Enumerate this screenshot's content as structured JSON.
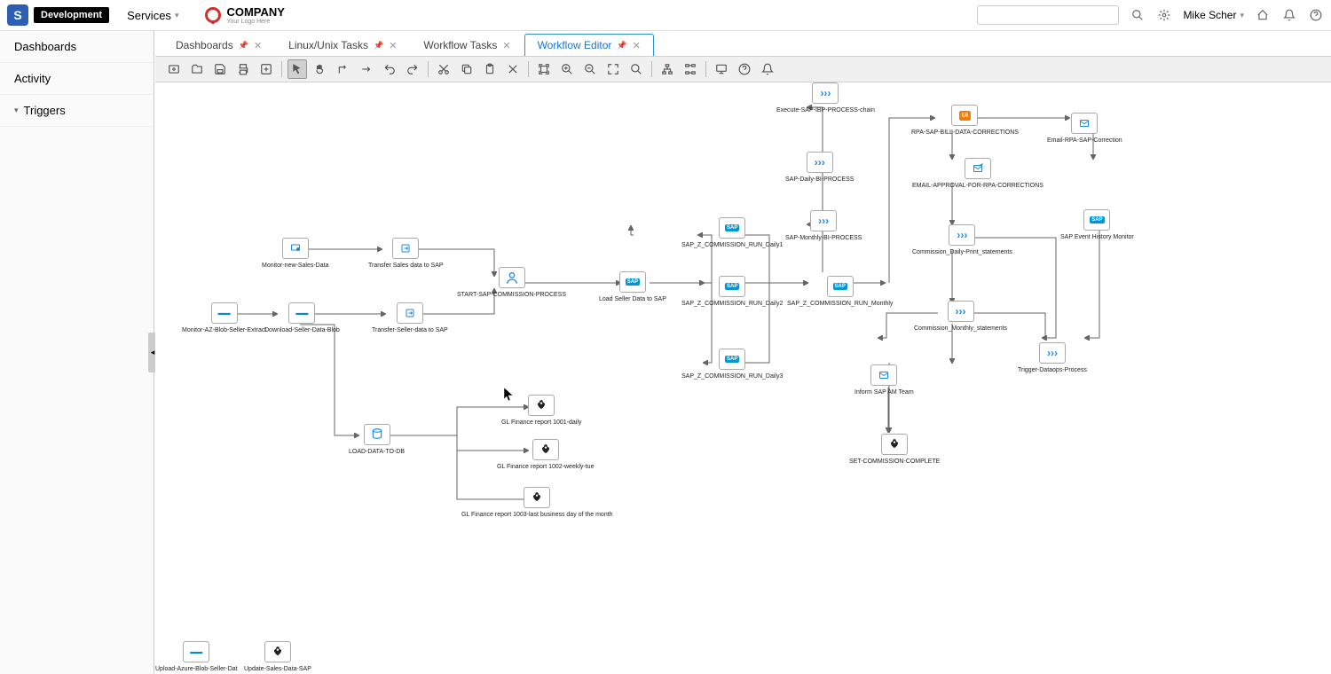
{
  "header": {
    "logo_letter": "S",
    "env_badge": "Development",
    "services": "Services",
    "company": "COMPANY",
    "company_sub": "Your Logo Here",
    "user": "Mike Scher"
  },
  "sidebar": {
    "items": [
      {
        "label": "Dashboards"
      },
      {
        "label": "Activity"
      },
      {
        "label": "Triggers",
        "expandable": true
      }
    ]
  },
  "tabs": [
    {
      "label": "Dashboards",
      "pinned": true,
      "closable": true
    },
    {
      "label": "Linux/Unix Tasks",
      "pinned": true,
      "closable": true
    },
    {
      "label": "Workflow Tasks",
      "closable": true
    },
    {
      "label": "Workflow Editor",
      "pinned": true,
      "closable": true,
      "active": true
    }
  ],
  "toolbar_icons": [
    "container",
    "folder",
    "save",
    "print",
    "add",
    "sep",
    "pointer",
    "hand",
    "connector-straight",
    "connector-arrow",
    "undo",
    "redo",
    "sep",
    "cut",
    "copy",
    "paste",
    "delete",
    "sep",
    "expand-select",
    "zoom-in",
    "zoom-out",
    "fit",
    "zoom",
    "sep",
    "layout-tree",
    "layout-grid",
    "sep",
    "monitor",
    "help",
    "bell"
  ],
  "nodes": {
    "monitor_new_sales": "Monitor-new-Sales-Data",
    "transfer_sales": "Transfer Sales data to SAP",
    "monitor_az_blob": "Monitor-AZ-Blob-Seller-Extract",
    "download_seller": "Download-Seller-Data-Blob",
    "transfer_seller": "Transfer-Seller-data to SAP",
    "start_sap_comm": "START-SAP-COMMISSION-PROCESS",
    "load_seller": "Load Seller Data to SAP",
    "sap_run_daily1": "SAP_Z_COMMISSION_RUN_Daily1",
    "sap_run_daily2": "SAP_Z_COMMISSION_RUN_Daily2",
    "sap_run_daily3": "SAP_Z_COMMISSION_RUN_Daily3",
    "sap_run_monthly": "SAP_Z_COMMISSION_RUN_Monthly",
    "sap_monthly_bi": "SAP-Monthly-BI-PROCESS",
    "sap_daily_bi": "SAP-Daily-BI-PROCESS",
    "execute_sap_ibp": "Execute-SAP-IBP-PROCESS-chain",
    "rpa_bill_corr": "RPA-SAP-BILL-DATA-CORRECTIONS",
    "email_rpa_corr": "Email-RPA-SAP-Correction",
    "email_approval": "EMAIL-APPROVAL-FOR-RPA-CORRECTIONS",
    "comm_daily_print": "Commission_Daily-Print_statements",
    "comm_monthly": "Commission_Monthly_statements",
    "sap_event_hist": "SAP Event History Monitor",
    "trigger_dataops": "Trigger-Dataops-Process",
    "inform_sap_am": "Inform SAP AM Team",
    "set_comm_complete": "SET-COMMISSION-COMPLETE",
    "load_data_db": "LOAD-DATA-TO-DB",
    "gl_1001": "GL Finance report 1001-daily",
    "gl_1002": "GL Finance report 1002-weekly-tue",
    "gl_1003": "GL Finance report 1003-last business day of the month",
    "upload_azure": "Upload-Azure-Blob-Seller-Dat",
    "update_sales": "Update-Sales-Data-SAP"
  }
}
